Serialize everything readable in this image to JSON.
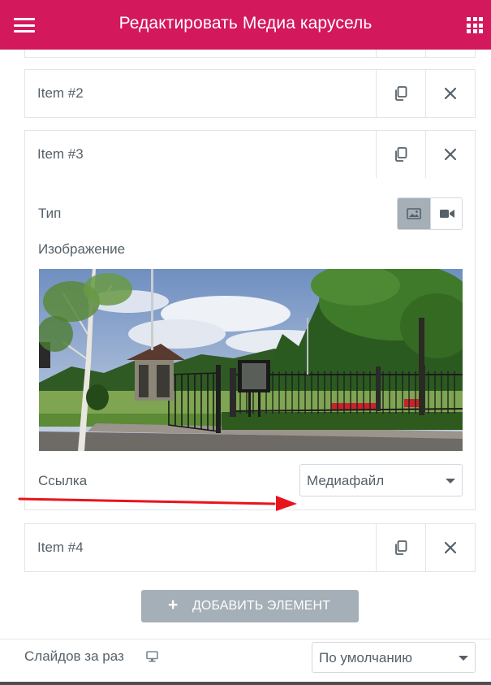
{
  "header": {
    "title": "Редактировать Медиа карусель"
  },
  "items": [
    {
      "label": "Item #2"
    },
    {
      "label": "Item #3"
    },
    {
      "label": "Item #4"
    }
  ],
  "panel": {
    "type_label": "Тип",
    "image_label": "Изображение",
    "link_label": "Ссылка",
    "link_value": "Медиафайл"
  },
  "add_button": {
    "plus": "+",
    "label": "ДОБАВИТЬ ЭЛЕМЕНТ"
  },
  "slides_per_view": {
    "label": "Слайдов за раз",
    "value": "По умолчанию"
  },
  "colors": {
    "brand": "#d3185c",
    "annotation_arrow": "#e8141c",
    "button_gray": "#a4afb7"
  },
  "icons": {
    "menu": "hamburger-icon",
    "apps": "grid-icon",
    "duplicate": "copy-icon",
    "remove": "close-icon",
    "image_type": "image-icon",
    "video_type": "video-camera-icon",
    "device": "desktop-icon",
    "dropdown": "caret-down-icon"
  }
}
